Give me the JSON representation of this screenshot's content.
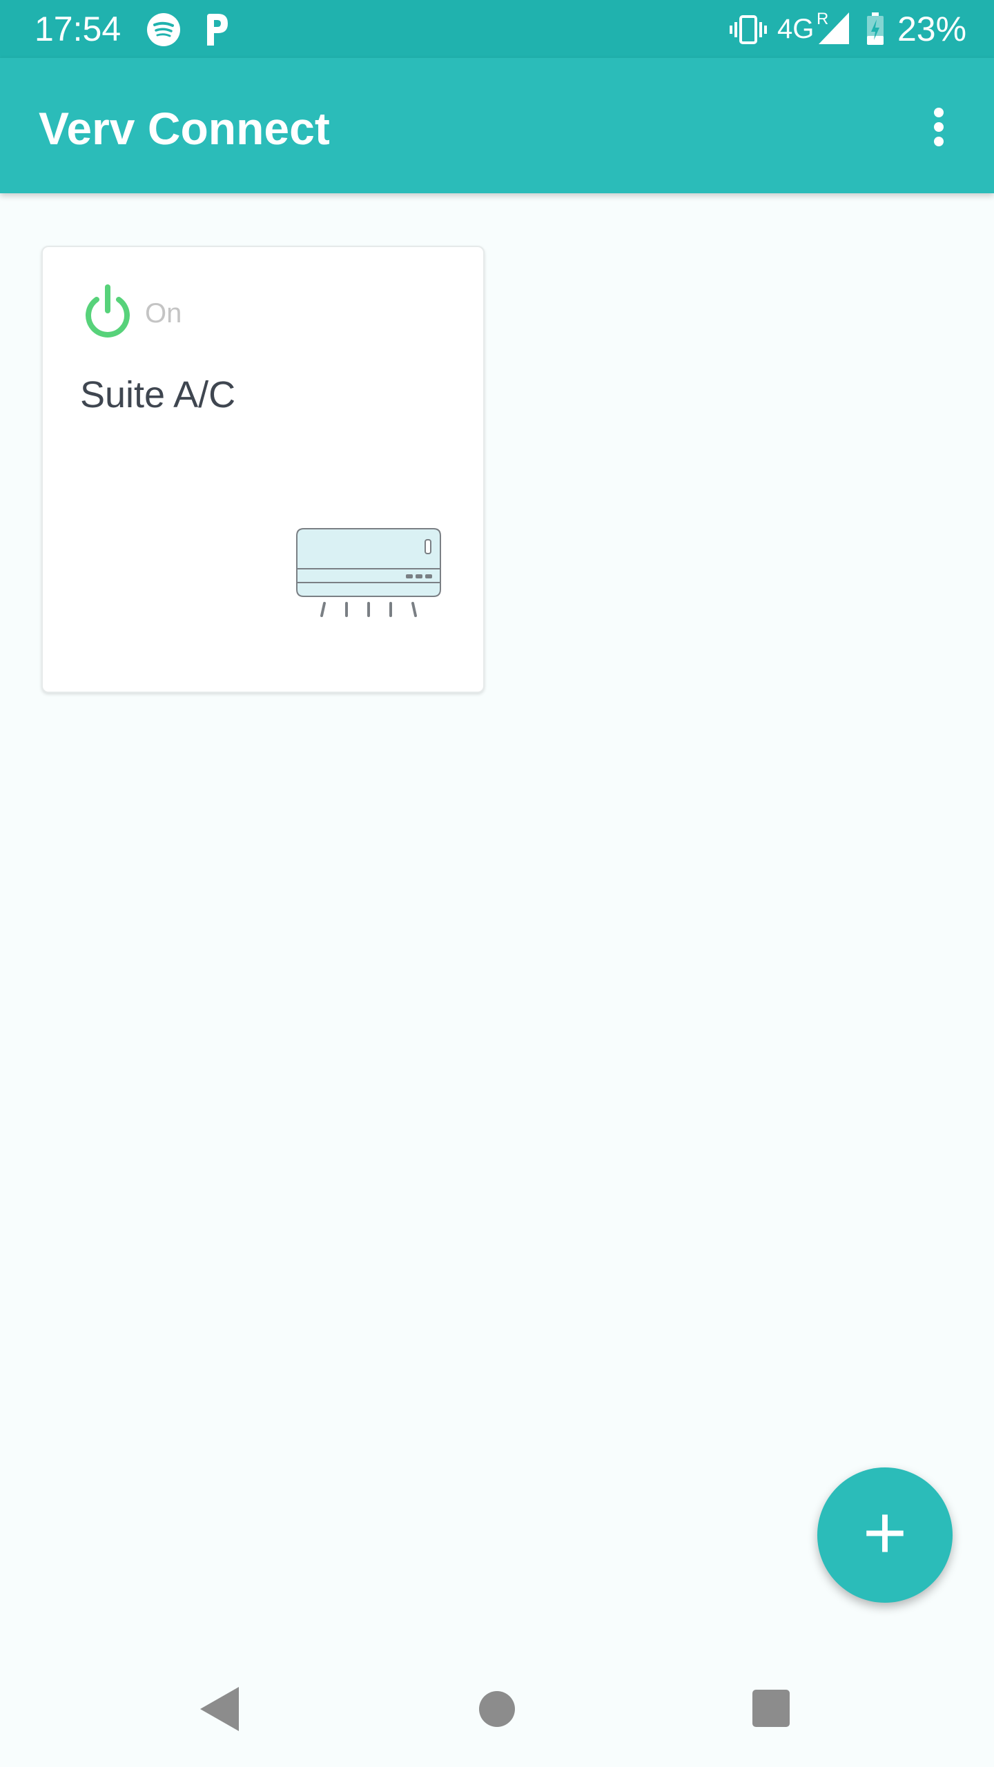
{
  "status_bar": {
    "time": "17:54",
    "network": "4G",
    "roaming": "R",
    "battery": "23%",
    "icons": [
      "spotify-icon",
      "p-app-icon",
      "vibrate-icon",
      "signal-icon",
      "battery-charging-icon"
    ]
  },
  "app_bar": {
    "title": "Verv Connect",
    "menu_icon": "more-vert-icon"
  },
  "devices": [
    {
      "state": "On",
      "name": "Suite A/C",
      "icon": "air-conditioner-icon",
      "state_color": "#57d27a"
    }
  ],
  "fab": {
    "label": "+",
    "icon": "add-icon"
  },
  "nav_bar": {
    "icons": [
      "back-icon",
      "home-icon",
      "recents-icon"
    ]
  },
  "colors": {
    "primary": "#2bbcb9",
    "status_bar": "#20b2ae",
    "background": "#f8fdfd"
  }
}
